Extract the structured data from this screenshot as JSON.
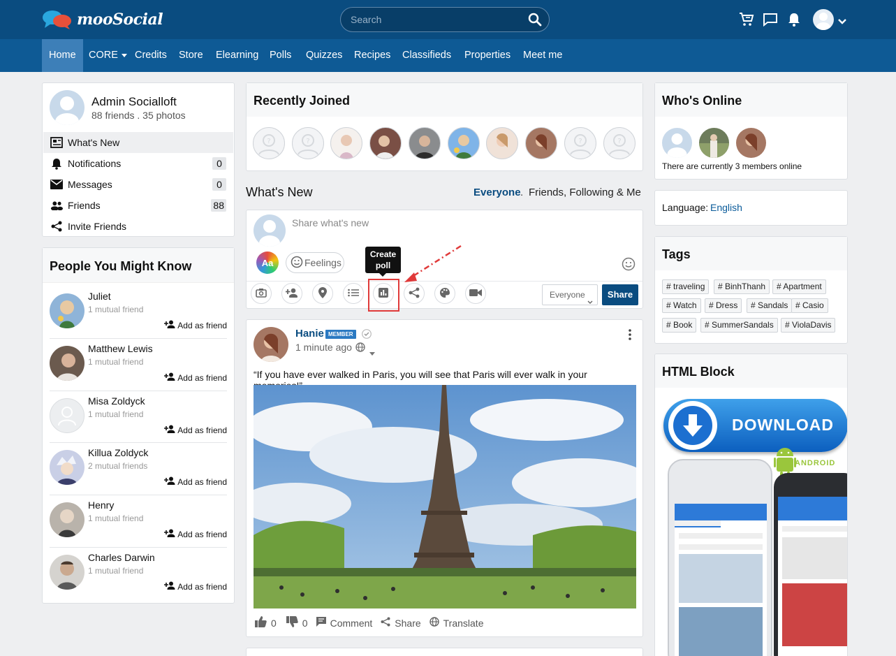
{
  "header": {
    "logo_text": "mooSocial",
    "search_placeholder": "Search"
  },
  "nav": {
    "items": [
      "Home",
      "CORE",
      "Credits",
      "Store",
      "Elearning",
      "Polls",
      "Quizzes",
      "Recipes",
      "Classifieds",
      "Properties",
      "Meet me"
    ]
  },
  "profile": {
    "name": "Admin Socialloft",
    "stats": "88 friends . 35 photos",
    "menu": [
      {
        "label": "What's New",
        "count": ""
      },
      {
        "label": "Notifications",
        "count": "0"
      },
      {
        "label": "Messages",
        "count": "0"
      },
      {
        "label": "Friends",
        "count": "88"
      },
      {
        "label": "Invite Friends",
        "count": ""
      }
    ]
  },
  "people": {
    "title": "People You Might Know",
    "add_label": "Add as friend",
    "items": [
      {
        "name": "Juliet",
        "mutual": "1 mutual friend"
      },
      {
        "name": "Matthew Lewis",
        "mutual": "1 mutual friend"
      },
      {
        "name": "Misa Zoldyck",
        "mutual": "1 mutual friend"
      },
      {
        "name": "Killua Zoldyck",
        "mutual": "2 mutual friends"
      },
      {
        "name": "Henry",
        "mutual": "1 mutual friend"
      },
      {
        "name": "Charles Darwin",
        "mutual": "1 mutual friend"
      }
    ]
  },
  "recent": {
    "title": "Recently Joined"
  },
  "feed": {
    "title": "What's New",
    "filter_everyone": "Everyone",
    "filter_sep": ".",
    "filter_friends": "Friends, Following & Me",
    "composer_placeholder": "Share what's new",
    "feelings_label": "Feelings",
    "font_label": "Aa",
    "tooltip": "Create poll",
    "privacy_value": "Everyone",
    "share_button": "Share"
  },
  "post": {
    "author": "Hanie",
    "badge": "MEMBER",
    "time": "1 minute ago",
    "text": "“If you have ever walked in Paris, you will see that Paris will ever walk in your memories!”",
    "likes": "0",
    "dislikes": "0",
    "comment_label": "Comment",
    "share_label": "Share",
    "translate_label": "Translate"
  },
  "online": {
    "title": "Who's Online",
    "text": "There are currently 3 members online"
  },
  "language": {
    "label": "Language:",
    "value": "English"
  },
  "tags": {
    "title": "Tags",
    "items": [
      "# traveling",
      "# BinhThanh",
      "# Apartment",
      "# Watch",
      "# Dress",
      "# Sandals",
      "# Casio",
      "# Book",
      "# SummerSandals",
      "# ViolaDavis"
    ]
  },
  "html_block": {
    "title": "HTML Block",
    "download_label": "DOWNLOAD",
    "android_label": "ANDROID"
  },
  "colors": {
    "header": "#0a4c80",
    "nav": "#0e5a95",
    "active_nav": "#3d7fb8",
    "accent": "#0a4c80"
  }
}
